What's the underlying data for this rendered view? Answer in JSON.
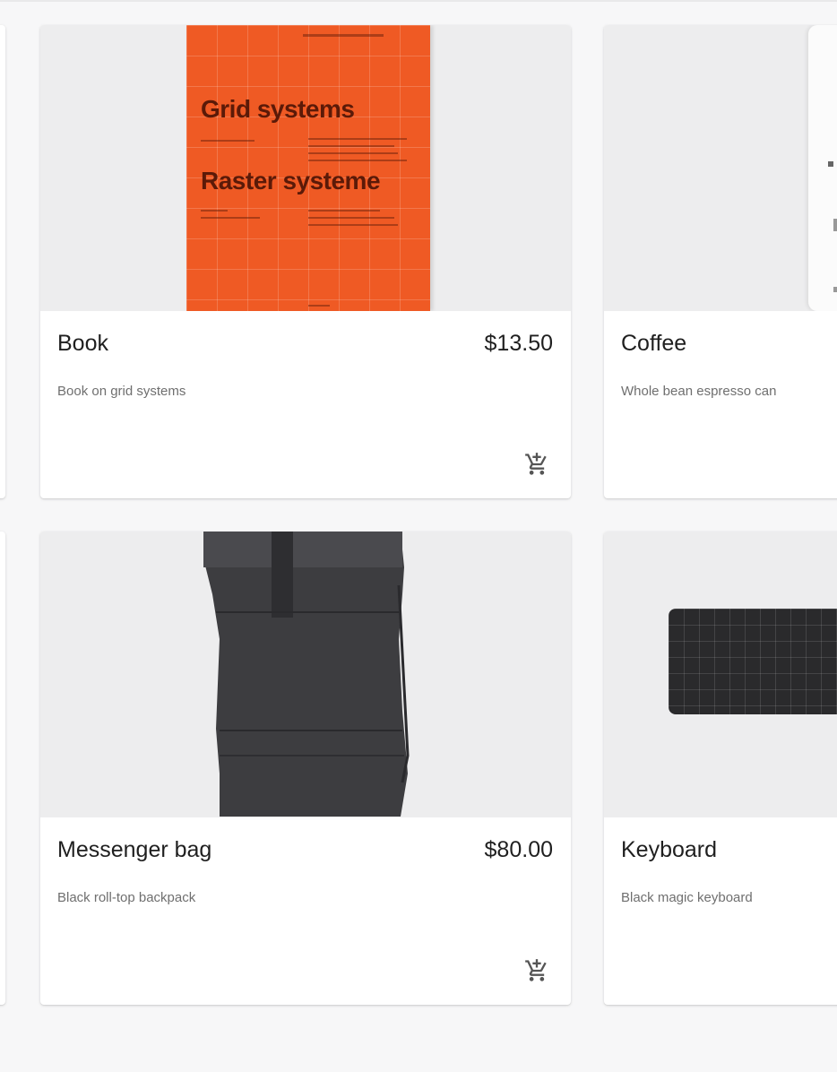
{
  "products": [
    {
      "name": "Book",
      "price": "$13.50",
      "description": "Book on grid systems",
      "cover_title_1": "Grid systems",
      "cover_title_2": "Raster systeme",
      "cart_icon": "add-shopping-cart"
    },
    {
      "name": "Coffee",
      "price": "",
      "description": "Whole bean espresso can"
    },
    {
      "name": "Messenger bag",
      "price": "$80.00",
      "description": "Black roll-top backpack",
      "cart_icon": "add-shopping-cart"
    },
    {
      "name": "Keyboard",
      "price": "",
      "description": "Black magic keyboard"
    }
  ],
  "colors": {
    "page_background": "#f7f7f8",
    "card_background": "#ffffff",
    "book_cover": "#ef5a24",
    "title_text": "#1f1f1f",
    "desc_text": "#6f6f6f"
  }
}
